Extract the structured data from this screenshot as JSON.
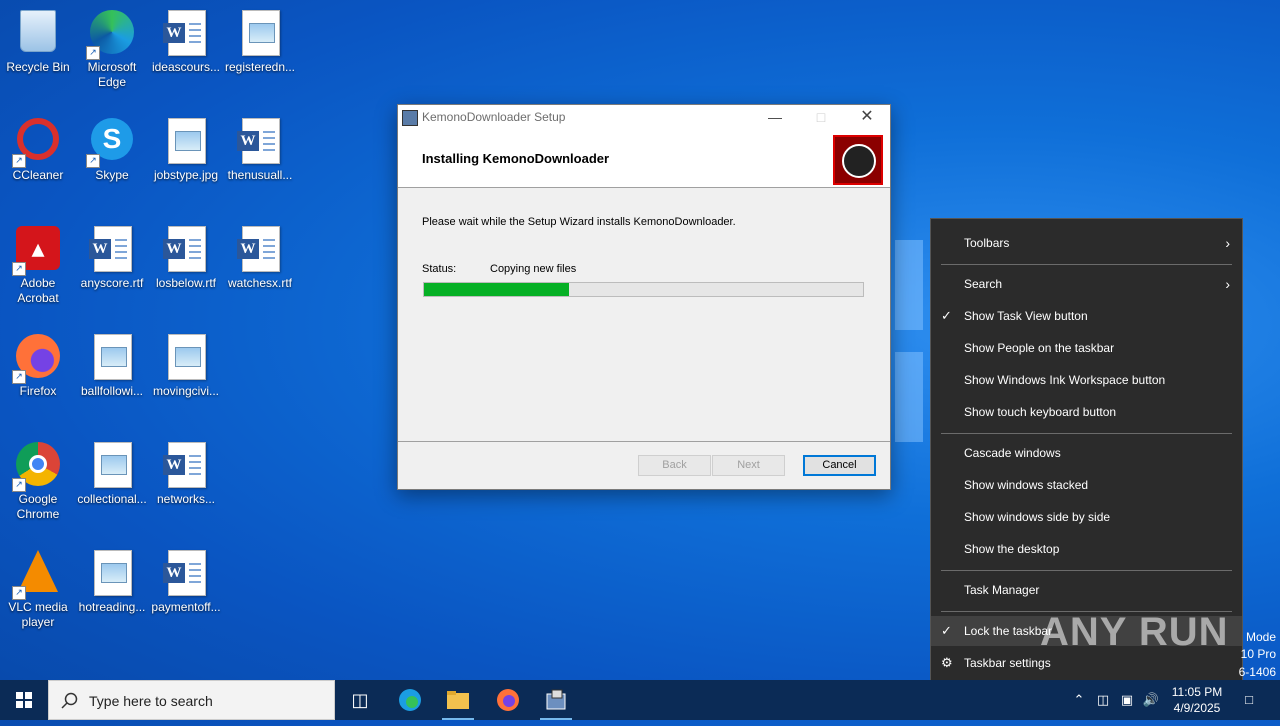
{
  "desktop": {
    "icons": [
      {
        "label": "Recycle Bin",
        "icon": "recycle-bin-icon"
      },
      {
        "label": "Microsoft Edge",
        "icon": "edge-icon"
      },
      {
        "label": "ideascours...",
        "icon": "word-doc-icon"
      },
      {
        "label": "registeredn...",
        "icon": "image-file-icon"
      },
      {
        "label": "CCleaner",
        "icon": "ccleaner-icon"
      },
      {
        "label": "Skype",
        "icon": "skype-icon"
      },
      {
        "label": "jobstype.jpg",
        "icon": "image-file-icon"
      },
      {
        "label": "thenusuall...",
        "icon": "word-doc-icon"
      },
      {
        "label": "Adobe Acrobat",
        "icon": "acrobat-icon"
      },
      {
        "label": "anyscore.rtf",
        "icon": "word-doc-icon"
      },
      {
        "label": "losbelow.rtf",
        "icon": "word-doc-icon"
      },
      {
        "label": "watchesx.rtf",
        "icon": "word-doc-icon"
      },
      {
        "label": "Firefox",
        "icon": "firefox-icon"
      },
      {
        "label": "ballfollowi...",
        "icon": "image-file-icon"
      },
      {
        "label": "movingcivi...",
        "icon": "image-file-icon"
      },
      {
        "label": "Google Chrome",
        "icon": "chrome-icon"
      },
      {
        "label": "collectional...",
        "icon": "image-file-icon"
      },
      {
        "label": "networks...",
        "icon": "word-doc-icon"
      },
      {
        "label": "VLC media player",
        "icon": "vlc-icon"
      },
      {
        "label": "hotreading...",
        "icon": "image-file-icon"
      },
      {
        "label": "paymentoff...",
        "icon": "word-doc-icon"
      }
    ]
  },
  "setup": {
    "title": "KemonoDownloader Setup",
    "heading": "Installing KemonoDownloader",
    "description": "Please wait while the Setup Wizard installs KemonoDownloader.",
    "status_label": "Status:",
    "status_value": "Copying new files",
    "progress_percent": 33,
    "back_label": "Back",
    "next_label": "Next",
    "cancel_label": "Cancel"
  },
  "context_menu": {
    "toolbars": "Toolbars",
    "search": "Search",
    "show_task_view": "Show Task View button",
    "show_people": "Show People on the taskbar",
    "show_ink": "Show Windows Ink Workspace button",
    "show_keyboard": "Show touch keyboard button",
    "cascade": "Cascade windows",
    "stacked": "Show windows stacked",
    "side_by_side": "Show windows side by side",
    "show_desktop": "Show the desktop",
    "task_manager": "Task Manager",
    "lock_taskbar": "Lock the taskbar",
    "taskbar_settings": "Taskbar settings"
  },
  "watermark": {
    "text": "ANY RUN",
    "side1": "Mode",
    "side2": "10 Pro",
    "side3": "6-1406"
  },
  "taskbar": {
    "search_placeholder": "Type here to search",
    "time": "11:05 PM",
    "date": "4/9/2025"
  }
}
